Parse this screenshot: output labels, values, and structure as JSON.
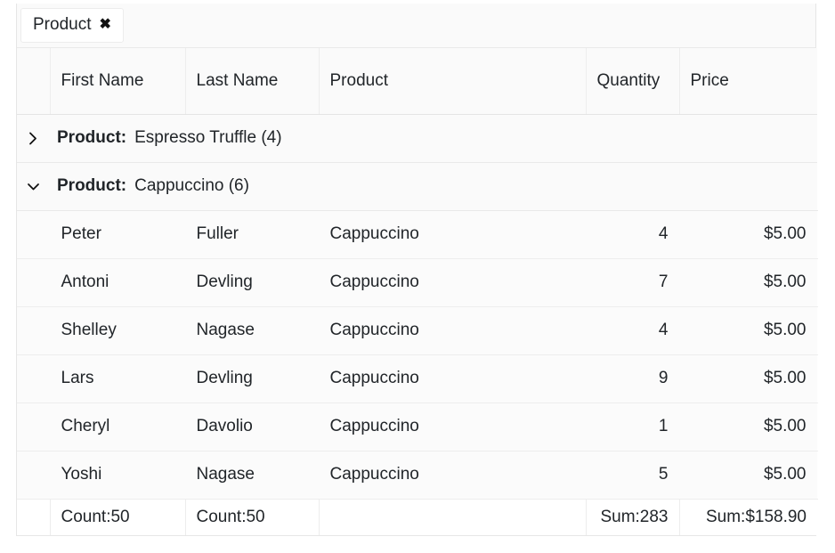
{
  "group_panel": {
    "chips": [
      {
        "label": "Product",
        "remove_icon": "close-icon",
        "remove_glyph": "✖"
      }
    ]
  },
  "table": {
    "columns": [
      {
        "key": "indent",
        "label": ""
      },
      {
        "key": "first",
        "label": "First Name"
      },
      {
        "key": "last",
        "label": "Last Name"
      },
      {
        "key": "product",
        "label": "Product"
      },
      {
        "key": "quantity",
        "label": "Quantity"
      },
      {
        "key": "price",
        "label": "Price"
      }
    ],
    "groups": [
      {
        "expanded": false,
        "toggle_icon": "chevron-right-icon",
        "label": "Product:",
        "value": "Espresso Truffle (4)",
        "rows": []
      },
      {
        "expanded": true,
        "toggle_icon": "chevron-down-icon",
        "label": "Product:",
        "value": "Cappuccino (6)",
        "rows": [
          {
            "first": "Peter",
            "last": "Fuller",
            "product": "Cappuccino",
            "quantity": "4",
            "price": "$5.00"
          },
          {
            "first": "Antoni",
            "last": "Devling",
            "product": "Cappuccino",
            "quantity": "7",
            "price": "$5.00"
          },
          {
            "first": "Shelley",
            "last": "Nagase",
            "product": "Cappuccino",
            "quantity": "4",
            "price": "$5.00"
          },
          {
            "first": "Lars",
            "last": "Devling",
            "product": "Cappuccino",
            "quantity": "9",
            "price": "$5.00"
          },
          {
            "first": "Cheryl",
            "last": "Davolio",
            "product": "Cappuccino",
            "quantity": "1",
            "price": "$5.00"
          },
          {
            "first": "Yoshi",
            "last": "Nagase",
            "product": "Cappuccino",
            "quantity": "5",
            "price": "$5.00"
          }
        ]
      }
    ],
    "footer": {
      "indent": "",
      "first": "Count:50",
      "last": "Count:50",
      "product": "",
      "quantity": "Sum:283",
      "price": "Sum:$158.90"
    }
  }
}
